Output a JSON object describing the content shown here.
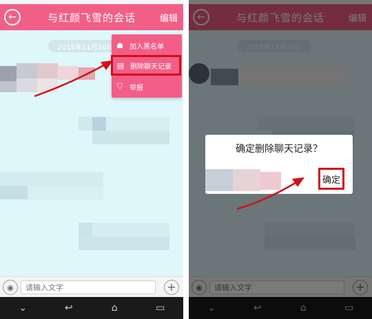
{
  "header": {
    "title": "与红颜飞雪的会话",
    "edit_label": "编辑",
    "back_icon": "back-arrow-icon"
  },
  "chat": {
    "date_label": "2015年11月20日"
  },
  "menu": {
    "items": [
      {
        "label": "加入黑名单",
        "icon": "user-block-icon"
      },
      {
        "label": "删除聊天记录",
        "icon": "trash-icon"
      },
      {
        "label": "举报",
        "icon": "shield-icon"
      }
    ]
  },
  "input": {
    "placeholder": "请输入文字"
  },
  "dialog": {
    "title": "确定删除聊天记录？",
    "confirm_label": "确定"
  },
  "colors": {
    "header_bg": "#f25f86",
    "menu_bg": "#f35e87",
    "chat_bg": "#def7fa",
    "highlight_red": "#d21018"
  }
}
